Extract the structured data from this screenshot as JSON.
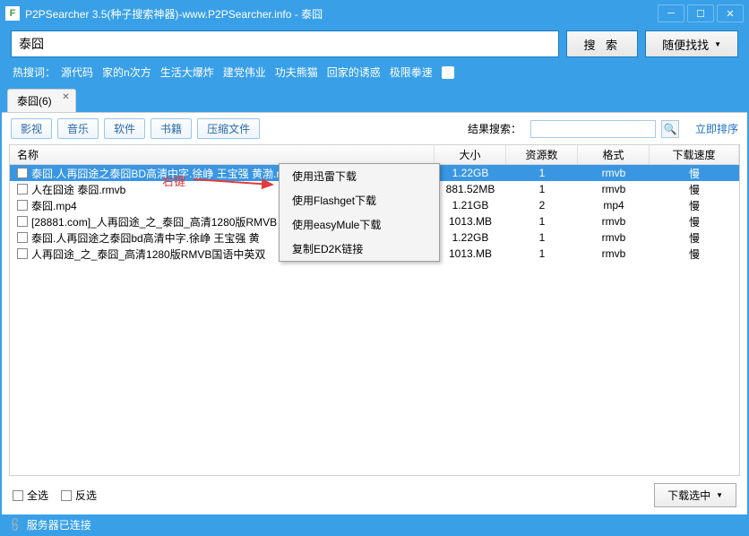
{
  "title": "P2PSearcher 3.5(种子搜索神器)-www.P2PSearcher.info - 泰囧",
  "search": {
    "value": "泰囧",
    "btn": "搜 索",
    "random": "随便找找"
  },
  "hotwords": {
    "label": "热搜词：",
    "items": [
      "源代码",
      "家的n次方",
      "生活大爆炸",
      "建党伟业",
      "功夫熊猫",
      "回家的诱惑",
      "极限拳速"
    ]
  },
  "tab": {
    "label": "泰囧(6)"
  },
  "filters": [
    "影视",
    "音乐",
    "软件",
    "书籍",
    "压缩文件"
  ],
  "result_search": {
    "label": "结果搜索："
  },
  "sort_link": "立即排序",
  "columns": {
    "name": "名称",
    "size": "大小",
    "sources": "资源数",
    "format": "格式",
    "speed": "下载速度"
  },
  "rows": [
    {
      "name": "泰囧.人再囧途之泰囧BD高清中字.徐峥 王宝强 黄渤.rmvb",
      "size": "1.22GB",
      "sources": "1",
      "format": "rmvb",
      "speed": "慢",
      "selected": true
    },
    {
      "name": "人在囧途 泰囧.rmvb",
      "size": "881.52MB",
      "sources": "1",
      "format": "rmvb",
      "speed": "慢"
    },
    {
      "name": "泰囧.mp4",
      "size": "1.21GB",
      "sources": "2",
      "format": "mp4",
      "speed": "慢"
    },
    {
      "name": "[28881.com]_人再囧途_之_泰囧_高清1280版RMVB",
      "size": "1013.MB",
      "sources": "1",
      "format": "rmvb",
      "speed": "慢"
    },
    {
      "name": "泰囧.人再囧途之泰囧bd高清中字.徐峥 王宝强 黄",
      "size": "1.22GB",
      "sources": "1",
      "format": "rmvb",
      "speed": "慢"
    },
    {
      "name": "人再囧途_之_泰囧_高清1280版RMVB国语中英双",
      "size": "1013.MB",
      "sources": "1",
      "format": "rmvb",
      "speed": "慢"
    }
  ],
  "annotation": "右键",
  "context_menu": [
    "使用迅雷下载",
    "使用Flashget下载",
    "使用easyMule下载",
    "复制ED2K链接"
  ],
  "footer": {
    "select_all": "全选",
    "invert": "反选",
    "download": "下载选中"
  },
  "status": "服务器已连接"
}
